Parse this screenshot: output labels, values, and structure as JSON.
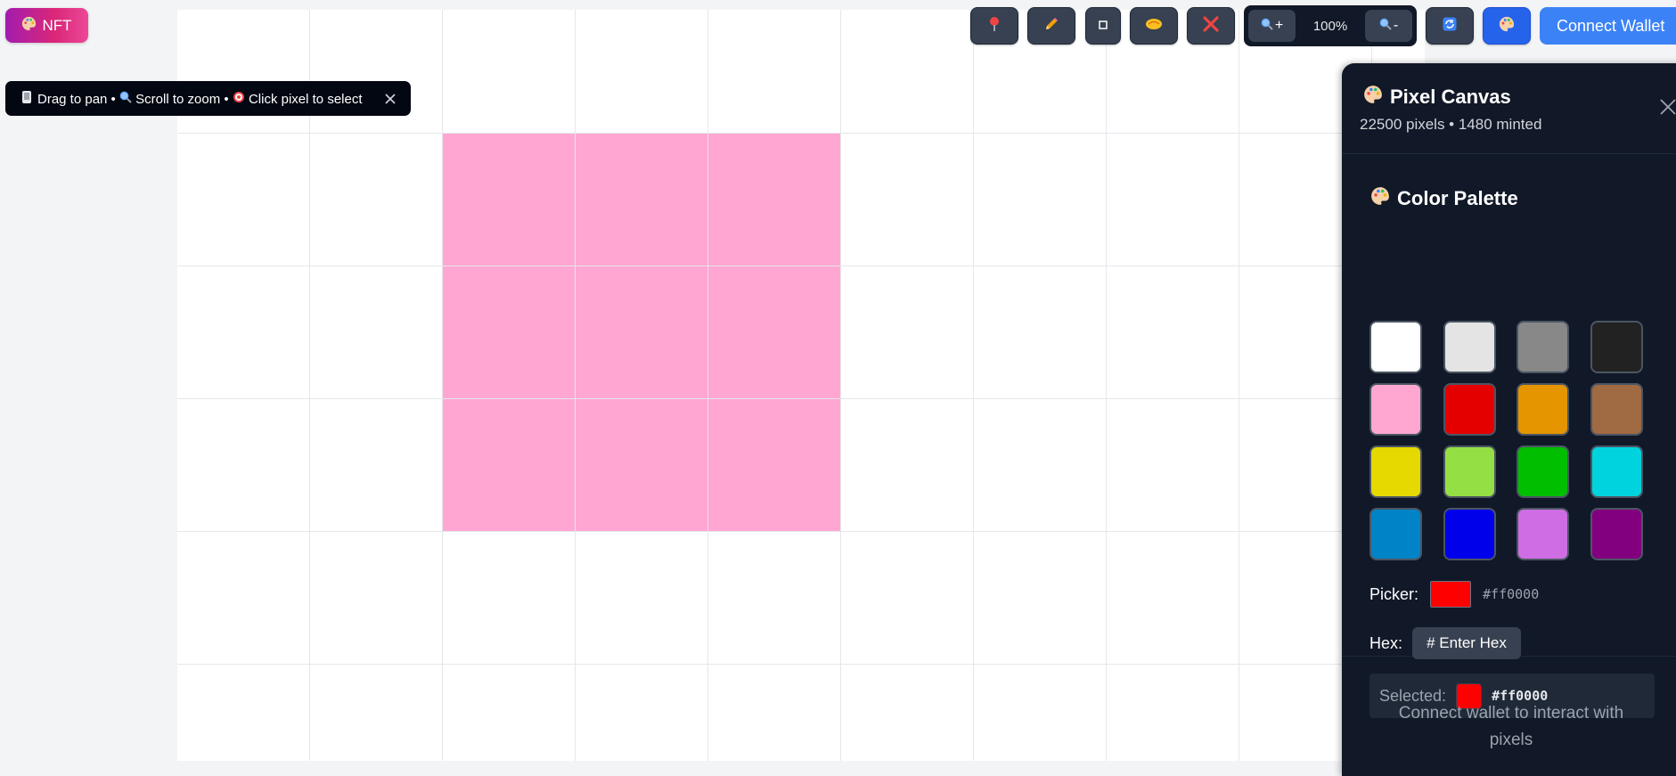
{
  "nft_button": {
    "label": "NFT",
    "icon": "palette-icon"
  },
  "hint": {
    "part1": "Drag to pan •",
    "part2": "Scroll to zoom •",
    "part3": "Click pixel to select",
    "icons": [
      "hand-icon",
      "magnifier-icon",
      "target-icon",
      "close-icon"
    ]
  },
  "toolbar": {
    "tools": [
      {
        "name": "pin-tool",
        "icon": "pushpin-icon"
      },
      {
        "name": "pencil-tool",
        "icon": "pencil-icon"
      },
      {
        "name": "square-tool",
        "icon": "square-icon"
      },
      {
        "name": "handshake-tool",
        "icon": "handshake-icon"
      },
      {
        "name": "clear-tool",
        "icon": "cross-mark-icon"
      }
    ],
    "zoom_in_label": "+",
    "zoom_out_label": "-",
    "zoom_level": "100%",
    "refresh_icon": "refresh-icon",
    "palette_icon": "palette-icon",
    "connect_wallet_label": "Connect Wallet"
  },
  "canvas": {
    "cell_count_visible": "12x6",
    "pink_block": {
      "color": "#ffa6d2",
      "cols": [
        2,
        3,
        4
      ],
      "rows": [
        1,
        2,
        3
      ]
    }
  },
  "panel": {
    "title": "Pixel Canvas",
    "subtitle": "22500 pixels • 1480 minted",
    "palette_title": "Color Palette",
    "palette": [
      "#ffffff",
      "#e4e4e4",
      "#888888",
      "#222222",
      "#ffa7d1",
      "#e50000",
      "#e59500",
      "#a06a42",
      "#e5d900",
      "#94e044",
      "#02be01",
      "#00d3dd",
      "#0083c7",
      "#0000ea",
      "#cf6ee4",
      "#820080"
    ],
    "picker_label": "Picker:",
    "picker_value": "#ff0000",
    "hex_label": "Hex:",
    "hex_button_label": "# Enter Hex",
    "selected_label": "Selected:",
    "selected_value": "#ff0000",
    "connect_message_line1": "Connect wallet to interact with",
    "connect_message_line2": "pixels"
  }
}
